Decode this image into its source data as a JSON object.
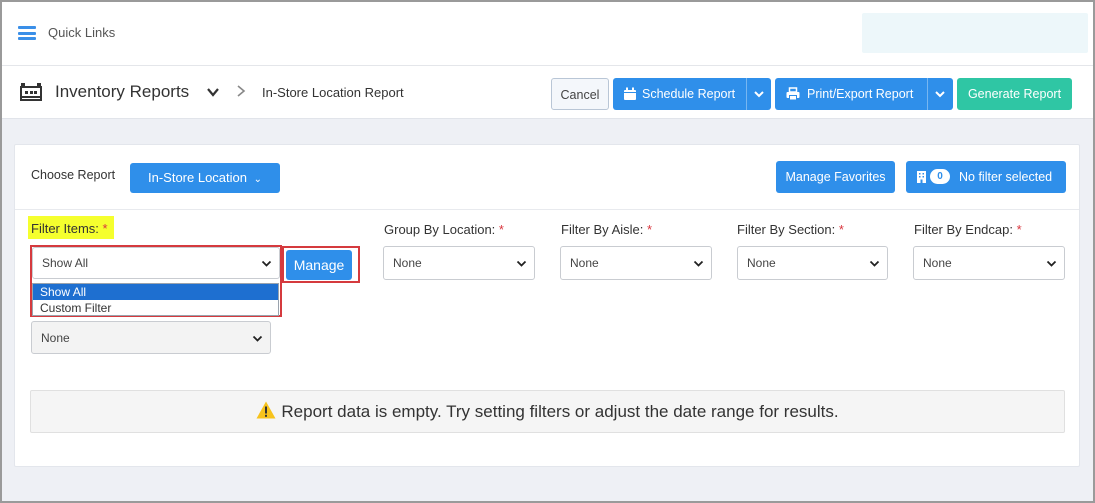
{
  "quick_links": {
    "label": "Quick Links",
    "icon": "hamburger-icon"
  },
  "header": {
    "title": "Inventory Reports",
    "breadcrumb_current": "In-Store Location Report",
    "buttons": {
      "cancel": "Cancel",
      "schedule": "Schedule Report",
      "print_export": "Print/Export Report",
      "generate": "Generate Report"
    }
  },
  "report": {
    "choose_label": "Choose Report",
    "selected_report": "In-Store Location",
    "manage_favorites": "Manage Favorites",
    "filter_count": "0",
    "filter_status": "No filter selected"
  },
  "filters": {
    "filter_items": {
      "label": "Filter Items:",
      "value": "Show All",
      "options": [
        "Show All",
        "Custom Filter"
      ],
      "manage_label": "Manage"
    },
    "group_by_location": {
      "label": "Group By Location:",
      "value": "None"
    },
    "filter_by_aisle": {
      "label": "Filter By Aisle:",
      "value": "None"
    },
    "filter_by_section": {
      "label": "Filter By Section:",
      "value": "None"
    },
    "filter_by_endcap": {
      "label": "Filter By Endcap:",
      "value": "None"
    },
    "extra_select": {
      "value": "None"
    },
    "required_mark": "*"
  },
  "empty_message": "Report data is empty. Try setting filters or adjust the date range for results.",
  "colors": {
    "primary": "#2f8fea",
    "success": "#2fc6a4",
    "highlight": "#f5ff2e",
    "annotation_red": "#d53a3e",
    "warning": "#f7c31c"
  }
}
